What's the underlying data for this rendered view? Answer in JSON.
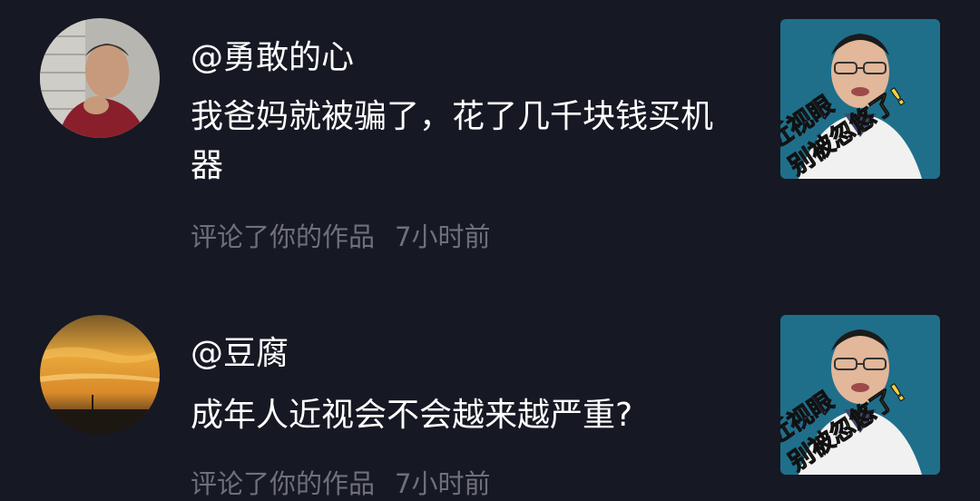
{
  "comments": [
    {
      "username": "@勇敢的心",
      "text": "我爸妈就被骗了，花了几千块钱买机器",
      "action": "评论了你的作品",
      "time": "7小时前",
      "thumb_caption_1": "近视眼",
      "thumb_caption_2": "别被忽悠了!"
    },
    {
      "username": "@豆腐",
      "text": "成年人近视会不会越来越严重?",
      "action": "评论了你的作品",
      "time": "7小时前",
      "thumb_caption_1": "近视眼",
      "thumb_caption_2": "别被忽悠了!"
    }
  ],
  "colors": {
    "background": "#161823",
    "primary_text": "#ffffff",
    "secondary_text": "#6f7079",
    "thumb_bg": "#1f6f8b"
  }
}
